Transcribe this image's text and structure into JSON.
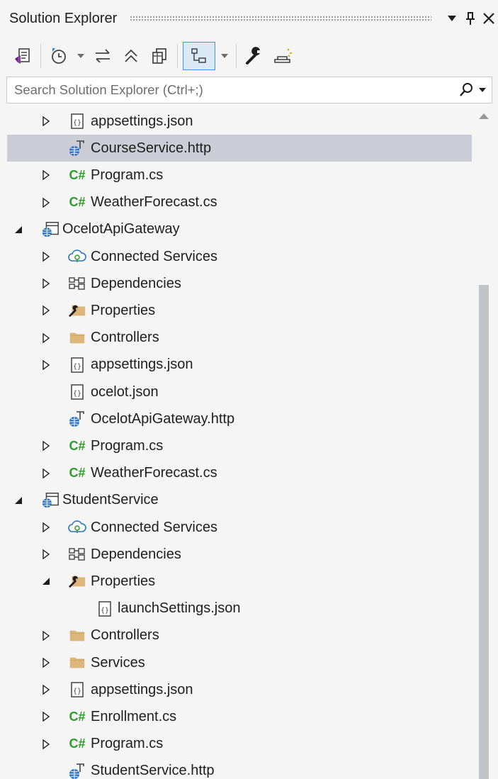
{
  "title_bar": {
    "title": "Solution Explorer",
    "dropdown_glyph": "▼",
    "pin_glyph": "ꟸ",
    "close_glyph": "✕"
  },
  "toolbar": {
    "buttons": [
      {
        "name": "switch-views-button",
        "icon": "vs-solution-icon"
      },
      {
        "name": "pending-changes-filter-button",
        "icon": "history-clock-icon"
      },
      {
        "name": "sync-with-active-document-button",
        "icon": "sync-arrows-icon"
      },
      {
        "name": "collapse-all-button",
        "icon": "collapse-chevrons-icon"
      },
      {
        "name": "show-all-files-button",
        "icon": "copy-files-icon"
      },
      {
        "name": "track-active-item-button",
        "icon": "tree-view-icon",
        "active": true
      },
      {
        "name": "properties-button",
        "icon": "wrench-icon"
      },
      {
        "name": "preview-selected-items-button",
        "icon": "preview-icon"
      }
    ]
  },
  "search": {
    "placeholder": "Search Solution Explorer (Ctrl+;)",
    "value": ""
  },
  "tree": {
    "items": [
      {
        "label": "appsettings.json",
        "icon": "json-file-icon",
        "level": 2,
        "expander": "collapsed"
      },
      {
        "label": "CourseService.http",
        "icon": "http-file-icon",
        "level": 2,
        "expander": "none",
        "selected": true
      },
      {
        "label": "Program.cs",
        "icon": "csharp-file-icon",
        "level": 2,
        "expander": "collapsed"
      },
      {
        "label": "WeatherForecast.cs",
        "icon": "csharp-file-icon",
        "level": 2,
        "expander": "collapsed"
      },
      {
        "label": "OcelotApiGateway",
        "icon": "web-project-icon",
        "level": 1,
        "expander": "expanded"
      },
      {
        "label": "Connected Services",
        "icon": "connected-services-icon",
        "level": 2,
        "expander": "collapsed"
      },
      {
        "label": "Dependencies",
        "icon": "dependencies-icon",
        "level": 2,
        "expander": "collapsed"
      },
      {
        "label": "Properties",
        "icon": "properties-folder-icon",
        "level": 2,
        "expander": "collapsed"
      },
      {
        "label": "Controllers",
        "icon": "folder-icon",
        "level": 2,
        "expander": "collapsed"
      },
      {
        "label": "appsettings.json",
        "icon": "json-file-icon",
        "level": 2,
        "expander": "collapsed"
      },
      {
        "label": "ocelot.json",
        "icon": "json-file-icon",
        "level": 2,
        "expander": "none"
      },
      {
        "label": "OcelotApiGateway.http",
        "icon": "http-file-icon",
        "level": 2,
        "expander": "none"
      },
      {
        "label": "Program.cs",
        "icon": "csharp-file-icon",
        "level": 2,
        "expander": "collapsed"
      },
      {
        "label": "WeatherForecast.cs",
        "icon": "csharp-file-icon",
        "level": 2,
        "expander": "collapsed"
      },
      {
        "label": "StudentService",
        "icon": "web-project-icon",
        "level": 1,
        "expander": "expanded"
      },
      {
        "label": "Connected Services",
        "icon": "connected-services-icon",
        "level": 2,
        "expander": "collapsed"
      },
      {
        "label": "Dependencies",
        "icon": "dependencies-icon",
        "level": 2,
        "expander": "collapsed"
      },
      {
        "label": "Properties",
        "icon": "properties-folder-icon",
        "level": 2,
        "expander": "expanded"
      },
      {
        "label": "launchSettings.json",
        "icon": "json-file-icon",
        "level": 3,
        "expander": "none"
      },
      {
        "label": "Controllers",
        "icon": "folder-icon",
        "level": 2,
        "expander": "collapsed"
      },
      {
        "label": "Services",
        "icon": "folder-icon",
        "level": 2,
        "expander": "collapsed"
      },
      {
        "label": "appsettings.json",
        "icon": "json-file-icon",
        "level": 2,
        "expander": "collapsed"
      },
      {
        "label": "Enrollment.cs",
        "icon": "csharp-file-icon",
        "level": 2,
        "expander": "collapsed"
      },
      {
        "label": "Program.cs",
        "icon": "csharp-file-icon",
        "level": 2,
        "expander": "collapsed"
      },
      {
        "label": "StudentService.http",
        "icon": "http-file-icon",
        "level": 2,
        "expander": "none"
      }
    ]
  },
  "colors": {
    "background": "#f5f5f5",
    "selection": "#ccccd6",
    "accent": "#3399ff",
    "csharp_green": "#2c9c2c",
    "folder_tan": "#dcb67a"
  }
}
